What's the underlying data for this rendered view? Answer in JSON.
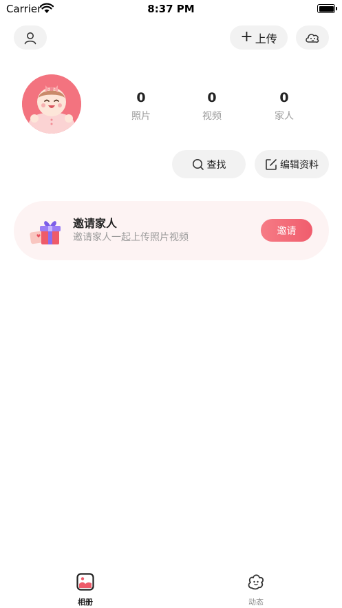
{
  "status_bar": {
    "carrier": "Carrier",
    "time": "8:37 PM"
  },
  "header": {
    "profile_icon": "person-icon",
    "upload_label": "上传",
    "cloud_icon": "cloud-face-icon"
  },
  "profile": {
    "avatar_icon": "baby-avatar",
    "stats": [
      {
        "value": "0",
        "label": "照片"
      },
      {
        "value": "0",
        "label": "视频"
      },
      {
        "value": "0",
        "label": "家人"
      }
    ]
  },
  "actions": {
    "search_label": "查找",
    "edit_label": "编辑资料"
  },
  "invite": {
    "title": "邀请家人",
    "subtitle": "邀请家人一起上传照片视频",
    "button_label": "邀请",
    "gift_icon": "gift-icon"
  },
  "tabbar": {
    "items": [
      {
        "label": "相册",
        "icon": "album-icon",
        "active": true
      },
      {
        "label": "动态",
        "icon": "moments-icon",
        "active": false
      }
    ]
  },
  "colors": {
    "accent": "#f05d6d",
    "card_bg": "#fdf3f3",
    "pill_bg": "#f2f2f2"
  }
}
